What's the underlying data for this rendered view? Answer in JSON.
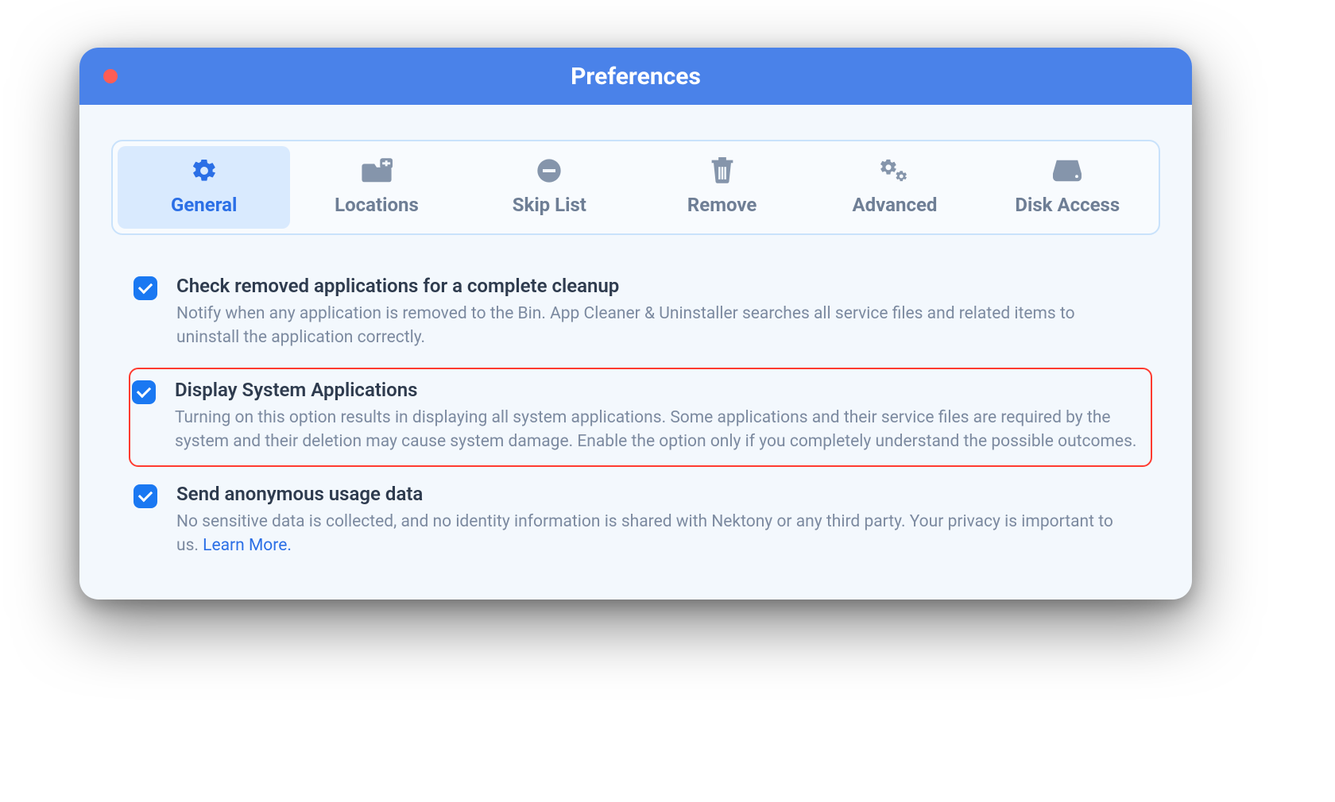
{
  "window": {
    "title": "Preferences"
  },
  "tabs": [
    {
      "label": "General",
      "icon": "gear-icon",
      "active": true
    },
    {
      "label": "Locations",
      "icon": "folder-plus-icon",
      "active": false
    },
    {
      "label": "Skip List",
      "icon": "minus-circle-icon",
      "active": false
    },
    {
      "label": "Remove",
      "icon": "trash-icon",
      "active": false
    },
    {
      "label": "Advanced",
      "icon": "gears-icon",
      "active": false
    },
    {
      "label": "Disk Access",
      "icon": "disk-icon",
      "active": false
    }
  ],
  "options": [
    {
      "checked": true,
      "highlighted": false,
      "title": "Check removed applications for a complete cleanup",
      "desc": "Notify when any application is removed to the Bin. App Cleaner & Uninstaller searches all service files and related items to uninstall the application correctly."
    },
    {
      "checked": true,
      "highlighted": true,
      "title": "Display System Applications",
      "desc": "Turning on this option results in displaying all system applications. Some applications and their service files are required by the system and their deletion may cause system damage. Enable the option only if you completely understand the possible outcomes."
    },
    {
      "checked": true,
      "highlighted": false,
      "title": "Send anonymous usage data",
      "desc": "No sensitive data is collected, and no identity information is shared with Nektony or any third party. Your privacy is important to us. ",
      "learn_more": "Learn More."
    }
  ],
  "colors": {
    "accent": "#2b6fe6",
    "checkbox": "#1a78f2",
    "titlebar": "#4a82e9",
    "highlight_border": "#ff3b30"
  }
}
